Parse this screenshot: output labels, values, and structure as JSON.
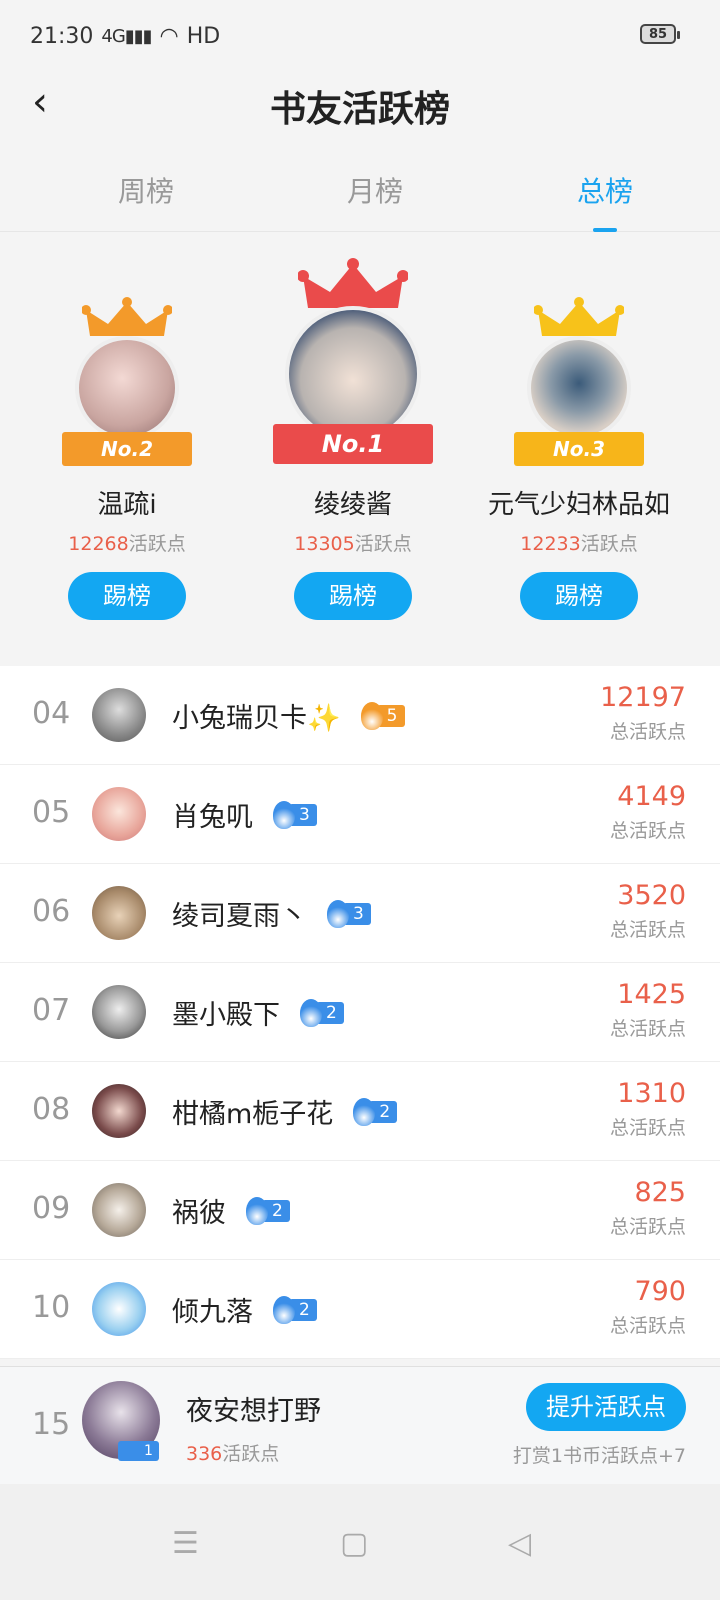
{
  "status": {
    "time": "21:30",
    "signal": "4G",
    "network": "HD",
    "battery": "85"
  },
  "header": {
    "title": "书友活跃榜"
  },
  "tabs": [
    {
      "label": "周榜",
      "active": false
    },
    {
      "label": "月榜",
      "active": false
    },
    {
      "label": "总榜",
      "active": true
    }
  ],
  "podium": [
    {
      "rank_label": "No.2",
      "name": "温疏i",
      "points": "12268",
      "points_unit": "活跃点",
      "button": "踢榜",
      "ribbon_color": "#f39a2a",
      "crown_color": "#f39a2a"
    },
    {
      "rank_label": "No.1",
      "name": "绫绫酱",
      "points": "13305",
      "points_unit": "活跃点",
      "button": "踢榜",
      "ribbon_color": "#ea4b4b",
      "crown_color": "#ea4b4b"
    },
    {
      "rank_label": "No.3",
      "name": "元气少妇林品如",
      "points": "12233",
      "points_unit": "活跃点",
      "button": "踢榜",
      "ribbon_color": "#f7b51a",
      "crown_color": "#f7c21a"
    }
  ],
  "list": [
    {
      "rank": "04",
      "name": "小兔瑞贝卡✨",
      "level": "5",
      "level_color": "#f39a2a",
      "score": "12197",
      "score_label": "总活跃点"
    },
    {
      "rank": "05",
      "name": "肖兔叽",
      "level": "3",
      "level_color": "#3a8ee8",
      "score": "4149",
      "score_label": "总活跃点"
    },
    {
      "rank": "06",
      "name": "绫司夏雨丶",
      "level": "3",
      "level_color": "#3a8ee8",
      "score": "3520",
      "score_label": "总活跃点"
    },
    {
      "rank": "07",
      "name": "墨小殿下",
      "level": "2",
      "level_color": "#3a8ee8",
      "score": "1425",
      "score_label": "总活跃点"
    },
    {
      "rank": "08",
      "name": "柑橘m栀子花",
      "level": "2",
      "level_color": "#3a8ee8",
      "score": "1310",
      "score_label": "总活跃点"
    },
    {
      "rank": "09",
      "name": "祸彼",
      "level": "2",
      "level_color": "#3a8ee8",
      "score": "825",
      "score_label": "总活跃点"
    },
    {
      "rank": "10",
      "name": "倾九落",
      "level": "2",
      "level_color": "#3a8ee8",
      "score": "790",
      "score_label": "总活跃点"
    }
  ],
  "me": {
    "rank": "15",
    "name": "夜安想打野",
    "level": "1",
    "points": "336",
    "points_unit": "活跃点",
    "button": "提升活跃点",
    "hint": "打赏1书币活跃点+7"
  },
  "colors": {
    "accent": "#13a7f2",
    "score": "#e9604a"
  }
}
